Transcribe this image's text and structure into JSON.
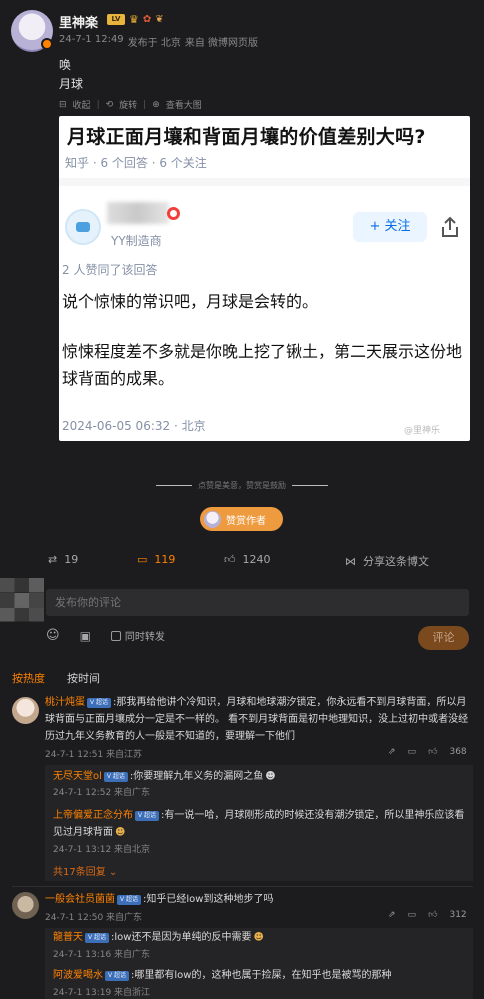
{
  "post": {
    "username": "里神楽",
    "level_badge": "LV",
    "timestamp": "24-7-1 12:49",
    "location": "发布于 北京",
    "source": "来自 微博网页版",
    "line1": "唤",
    "line2": "月球"
  },
  "image_toolbar": {
    "collect": "收起",
    "rotate": "旋转",
    "view_large": "查看大图"
  },
  "zhihu_card": {
    "question": "月球正面月壤和背面月壤的价值差别大吗?",
    "question_meta": "知乎 · 6 个回答 · 6 个关注",
    "author": "YY制造商",
    "follow_label": "+ 关注",
    "likes": "2 人赞同了该回答",
    "answer_line1": "说个惊悚的常识吧，月球是会转的。",
    "answer_line2": "惊悚程度差不多就是你晚上挖了锹土，第二天展示这份地球背面的成果。",
    "answer_date": "2024-06-05 06:32 · 北京",
    "watermark": "@里神乐"
  },
  "appreciation": {
    "caption": "点赞是美意，赞赏是鼓励",
    "tip_button": "赞赏作者"
  },
  "actions": {
    "reposts": "19",
    "comments": "119",
    "likes": "1240",
    "share": "分享这条博文"
  },
  "composer": {
    "placeholder": "发布你的评论",
    "repost_checkbox": "同时转发",
    "submit": "评论"
  },
  "sort": {
    "by_hot": "按热度",
    "by_time": "按时间"
  },
  "comments": [
    {
      "name": "桃汁炖蛋",
      "badge": "V 超话",
      "text": ":那我再给他讲个冷知识，月球和地球潮汐锁定，你永远看不到月球背面，所以月球背面与正面月壤成分一定是不一样的。 看不到月球背面是初中地理知识，没上过初中或者没经历过九年义务教育的人一般是不知道的，要理解一下他们",
      "meta": "24-7-1 12:51 来自江苏",
      "likes": "368",
      "replies": [
        {
          "name": "无尽天堂ol",
          "badge": "V 超话",
          "text": ":你要理解九年义务的漏网之鱼",
          "meta": "24-7-1 12:52 来自广东"
        },
        {
          "name": "上帝偏爱正念分布",
          "badge": "V 超话",
          "text": ":有一说一哈，月球刚形成的时候还没有潮汐锁定，所以里神乐应该看见过月球背面",
          "meta": "24-7-1 13:12 来自北京"
        }
      ],
      "more": "共17条回复 ⌄"
    },
    {
      "name": "一般会社员菌菌",
      "badge": "V 超话",
      "text": ":知乎已经low到这种地步了吗",
      "meta": "24-7-1 12:50 来自广东",
      "likes": "312",
      "replies": [
        {
          "name": "龍普天",
          "badge": "V 超话",
          "text": ":low还不是因为单纯的反中需要",
          "meta": "24-7-1 13:16 来自广东"
        },
        {
          "name": "阿波爱喝水",
          "badge": "V 超话",
          "text": ":哪里都有low的，这种也属于捡屎，在知乎也是被骂的那种",
          "meta": "24-7-1 13:19 来自浙江"
        }
      ]
    }
  ]
}
